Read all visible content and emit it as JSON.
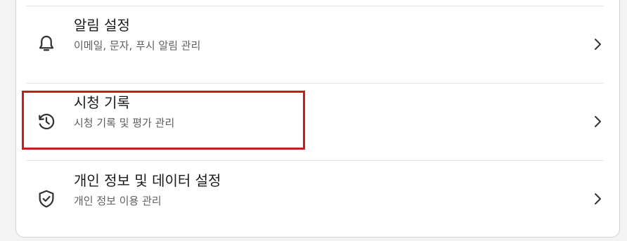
{
  "settings": {
    "items": [
      {
        "icon": "bell-icon",
        "title": "알림 설정",
        "subtitle": "이메일, 문자, 푸시 알림 관리"
      },
      {
        "icon": "history-icon",
        "title": "시청 기록",
        "subtitle": "시청 기록 및 평가 관리"
      },
      {
        "icon": "shield-check-icon",
        "title": "개인 정보 및 데이터 설정",
        "subtitle": "개인 정보 이용 관리"
      }
    ]
  },
  "colors": {
    "highlight": "#cc1b1b",
    "card_background": "#ffffff",
    "title_text": "#1a1a1a",
    "subtitle_text": "#5f5f5f"
  }
}
